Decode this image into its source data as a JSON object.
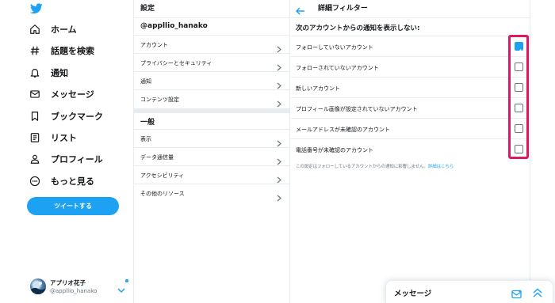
{
  "colors": {
    "accent": "#1da1f2",
    "highlight": "#e0165e",
    "text": "#14171a",
    "muted": "#657786",
    "border": "#e6ecf0"
  },
  "nav": {
    "logo_icon": "twitter-bird-icon",
    "items": [
      {
        "label": "ホーム",
        "icon": "home-icon"
      },
      {
        "label": "話題を検索",
        "icon": "hashtag-icon"
      },
      {
        "label": "通知",
        "icon": "bell-icon"
      },
      {
        "label": "メッセージ",
        "icon": "envelope-icon"
      },
      {
        "label": "ブックマーク",
        "icon": "bookmark-icon"
      },
      {
        "label": "リスト",
        "icon": "list-icon"
      },
      {
        "label": "プロフィール",
        "icon": "person-icon"
      },
      {
        "label": "もっと見る",
        "icon": "more-icon"
      }
    ],
    "tweet_button": "ツイートする"
  },
  "account": {
    "name": "アプリオ花子",
    "handle": "@appllio_hanako"
  },
  "settings": {
    "title": "設定",
    "username": "@appllio_hanako",
    "items": [
      {
        "label": "アカウント"
      },
      {
        "label": "プライバシーとセキュリティ"
      },
      {
        "label": "通知"
      },
      {
        "label": "コンテンツ設定"
      }
    ],
    "general_title": "一般",
    "general_items": [
      {
        "label": "表示"
      },
      {
        "label": "データ通信量"
      },
      {
        "label": "アクセシビリティ"
      },
      {
        "label": "その他のリソース"
      }
    ]
  },
  "filter": {
    "title": "詳細フィルター",
    "heading": "次のアカウントからの通知を表示しない:",
    "options": [
      {
        "label": "フォローしていないアカウント",
        "checked": true
      },
      {
        "label": "フォローされていないアカウント",
        "checked": false
      },
      {
        "label": "新しいアカウント",
        "checked": false
      },
      {
        "label": "プロフィール画像が設定されていないアカウント",
        "checked": false
      },
      {
        "label": "メールアドレスが未確認のアカウント",
        "checked": false
      },
      {
        "label": "電話番号が未確認のアカウント",
        "checked": false
      }
    ],
    "note": "この設定はフォローしているアカウントからの通知に影響しません。",
    "note_link": "詳細はこちら"
  },
  "messages_drawer": {
    "title": "メッセージ"
  }
}
